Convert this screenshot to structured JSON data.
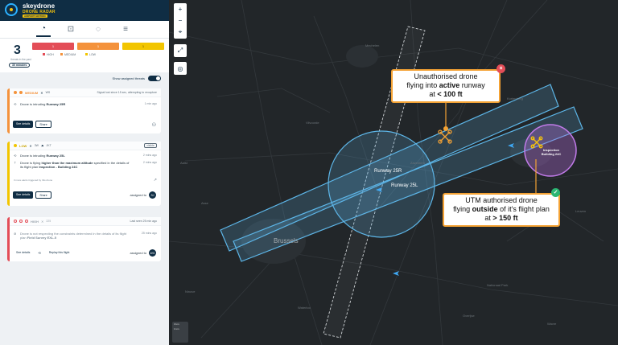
{
  "brand": {
    "name": "skeydrone",
    "product": "DRONE RADAR",
    "edition": "AIRPORT EDITION"
  },
  "tabs": [
    {
      "icon": "dashboard-icon",
      "glyph": "◔"
    },
    {
      "icon": "zone-icon",
      "glyph": "⊡"
    },
    {
      "icon": "drone-shield-icon",
      "glyph": "◌"
    },
    {
      "icon": "menu-icon",
      "glyph": "≡"
    }
  ],
  "summary": {
    "count": "3",
    "caption": "threats in the past",
    "time_window": "30 minutes",
    "bars": {
      "high": "1",
      "medium": "1",
      "low": "1"
    },
    "legend": {
      "high": "HIGH",
      "medium": "MEDIUM",
      "low": "LOW"
    }
  },
  "assigned_toggle_label": "Show assigned threats",
  "threats": [
    {
      "severity": "MEDIUM",
      "id": "WS",
      "head_right": "Signal lost since 15 sec, attempting to recapture",
      "message_pre": "Drone is intruding ",
      "message_bold": "Runway 25R",
      "time": "1 min ago",
      "see_details": "See details",
      "share": "Share"
    },
    {
      "severity": "LOW",
      "id": "3W",
      "id2": "JKT",
      "tag": "visible",
      "line1_pre": "Drone is intruding ",
      "line1_bold": "Runway 25L",
      "line1_time": "2 mins ago",
      "line2_pre": "Drone is flying ",
      "line2_bold": "higher than the maximum altitude",
      "line2_post": " specified in the details of its flight plan ",
      "line2_plan": "Inspection - Building 24C",
      "line2_time": "2 mins ago",
      "more_alerts": "3 more alerts triggered by this drone",
      "see_details": "See details",
      "share": "Share",
      "assigned": "assigned to",
      "avatar": "SJ"
    },
    {
      "severity": "HIGH",
      "id": "225",
      "head_right": "Last seen 25 min ago",
      "line_pre": "Drone is not respecting the constraints determined in the details of its flight plan ",
      "line_plan": "Field Survey EXL-5",
      "time": "25 mins ago",
      "see_details": "See details",
      "replay": "Replay this flight",
      "assigned": "assigned to",
      "avatar": "WG"
    }
  ],
  "map": {
    "controls": [
      "+",
      "−",
      "⌖"
    ],
    "runway_label_1": "Runway 25R",
    "runway_label_2": "Runway 25L",
    "city": "Brussels",
    "inspection_label": "Inspection Building 24C",
    "callout_top": {
      "l1": "Unauthorised drone",
      "l2a": "flying into ",
      "l2b": "active",
      "l2c": " runway",
      "l3a": "at ",
      "l3b": "< 100 ft"
    },
    "callout_bottom": {
      "l1": "UTM authorised drone",
      "l2a": "flying ",
      "l2b": "outside",
      "l2c": " of it's flight plan",
      "l3a": "at ",
      "l3b": "> 150 ft"
    },
    "scale": [
      "3 km",
      "1 km"
    ],
    "places": [
      "Mechelen",
      "Vilvoorde",
      "Zaventem",
      "Leuven",
      "Overijse",
      "Kortenberg",
      "Wavre",
      "Waterloo",
      "Asse",
      "Aalst",
      "Ninove",
      "Nationaal Park"
    ]
  },
  "colors": {
    "navy": "#0f2d44",
    "high": "#e34d57",
    "medium": "#f4923b",
    "low": "#f2c500",
    "runway": "#5db6e8",
    "callout": "#f4a234"
  }
}
